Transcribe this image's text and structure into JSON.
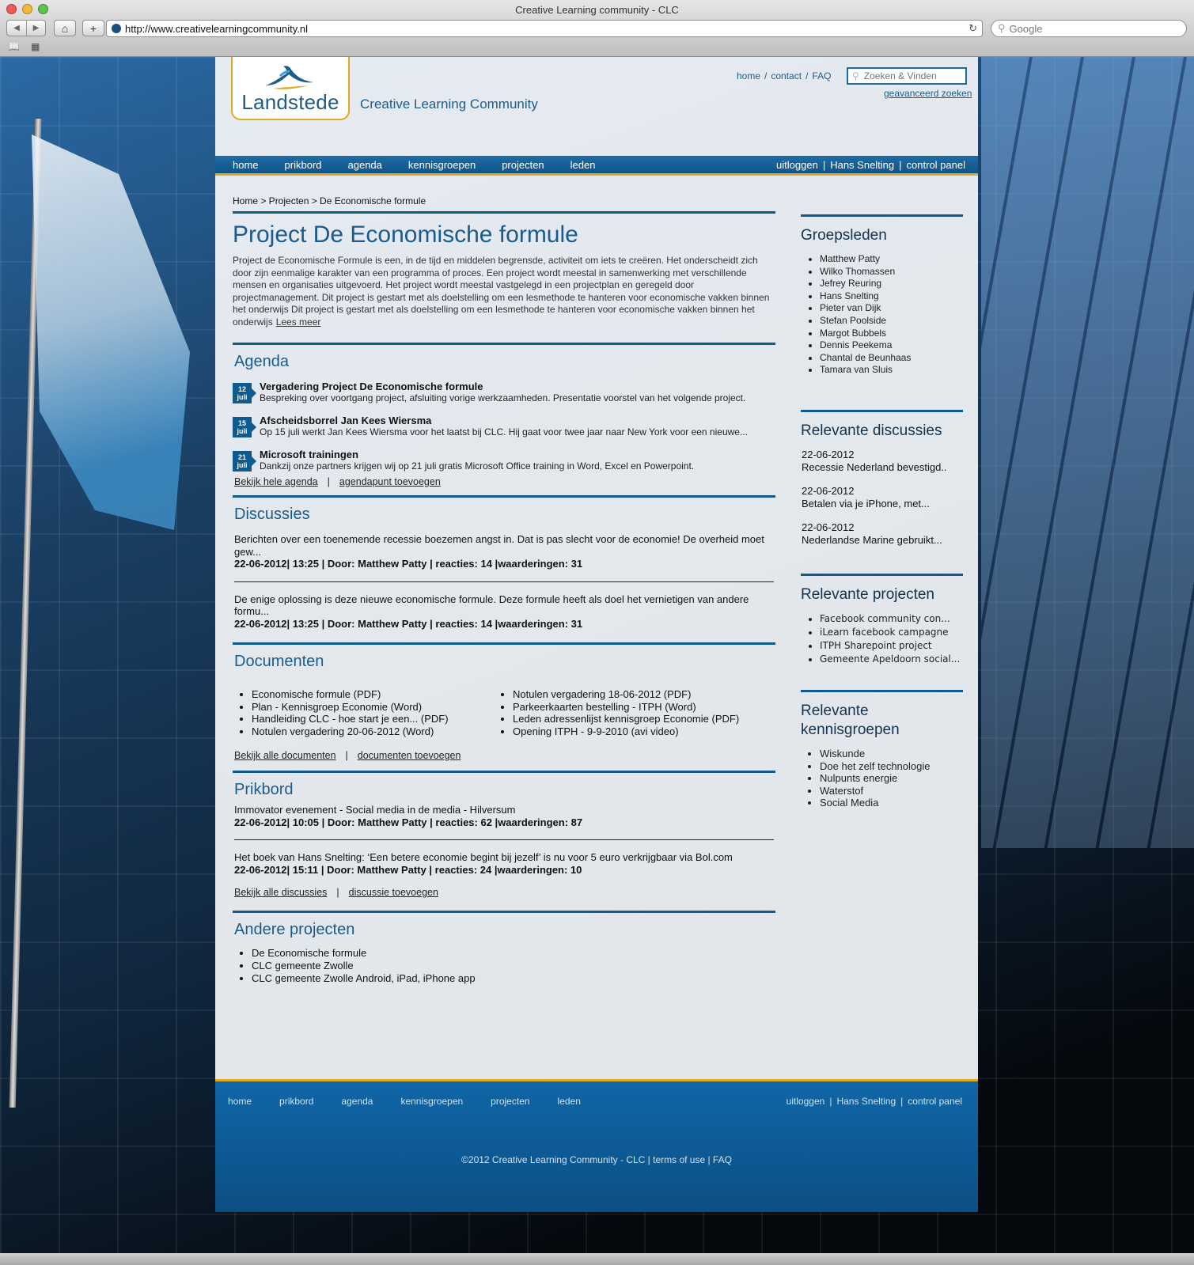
{
  "browser": {
    "window_title": "Creative Learning community - CLC",
    "url": "http://www.creativelearningcommunity.nl",
    "search_placeholder": "Google"
  },
  "site": {
    "logo_text": "Landstede",
    "tagline": "Creative Learning Community",
    "toplinks": [
      "home",
      "contact",
      "FAQ"
    ],
    "search_placeholder": "Zoeken & Vinden",
    "advanced_search": "geavanceerd zoeken"
  },
  "nav": {
    "items": [
      "home",
      "prikbord",
      "agenda",
      "kennisgroepen",
      "projecten",
      "leden"
    ],
    "right": [
      "uitloggen",
      "Hans Snelting",
      "control panel"
    ]
  },
  "main": {
    "breadcrumb": "Home > Projecten > De Economische formule",
    "title": "Project De Economische formule",
    "intro": "Project de Economische Formule is een, in de tijd en middelen begrensde, activiteit om iets te creëren. Het onderscheidt zich door zijn eenmalige karakter van een programma of proces. Een project wordt meestal in samenwerking met verschillende mensen en organisaties uitgevoerd. Het project wordt meestal vastgelegd in een projectplan en geregeld door projectmanagement. Dit project is gestart met als doelstelling om een lesmethode te hanteren voor economische vakken binnen het onderwijs  Dit project is gestart met als doelstelling om een lesmethode te hanteren voor economische vakken binnen het onderwijs",
    "read_more": "Lees meer",
    "agenda": {
      "heading": "Agenda",
      "items": [
        {
          "day": "12",
          "month": "juli",
          "title": "Vergadering Project De Economische formule",
          "desc": "Bespreking over voortgang project, afsluiting vorige werkzaamheden. Presentatie voorstel van het volgende project."
        },
        {
          "day": "15",
          "month": "juli",
          "title": "Afscheidsborrel Jan Kees Wiersma",
          "desc": "Op 15 juli werkt Jan Kees Wiersma voor het laatst bij CLC. Hij gaat voor twee jaar naar New York voor een nieuwe..."
        },
        {
          "day": "21",
          "month": "juli",
          "title": "Microsoft trainingen",
          "desc": "Dankzij onze partners krijgen wij op 21 juli gratis Microsoft Office training in Word, Excel en Powerpoint."
        }
      ],
      "link_all": "Bekijk hele agenda",
      "link_add": "agendapunt toevoegen"
    },
    "discussions": {
      "heading": "Discussies",
      "items": [
        {
          "text": "Berichten over een toenemende recessie boezemen angst in. Dat is pas slecht voor de economie! De overheid moet gew...",
          "meta": "22-06-2012| 13:25 | Door: Matthew Patty | reacties: 14 |waarderingen: 31"
        },
        {
          "text": "De enige oplossing is deze nieuwe economische formule. Deze formule heeft als doel het vernietigen van andere formu...",
          "meta": "22-06-2012| 13:25 | Door: Matthew Patty | reacties: 14 |waarderingen: 31"
        }
      ],
      "separator": "______________________________________________________________________________________"
    },
    "documents": {
      "heading": "Documenten",
      "col1": [
        "Economische formule (PDF)",
        "Plan - Kennisgroep Economie (Word)",
        "Handleiding CLC - hoe start je een... (PDF)",
        "Notulen vergadering 20-06-2012 (Word)"
      ],
      "col2": [
        "Notulen vergadering 18-06-2012 (PDF)",
        "Parkeerkaarten bestelling - ITPH (Word)",
        "Leden adressenlijst kennisgroep Economie (PDF)",
        "Opening ITPH - 9-9-2010 (avi video)"
      ],
      "link_all": "Bekijk alle documenten",
      "link_add": "documenten toevoegen"
    },
    "prikbord": {
      "heading": "Prikbord",
      "items": [
        {
          "text": "Immovator evenement - Social media in de media - Hilversum",
          "meta": "22-06-2012| 10:05 | Door: Matthew Patty | reacties: 62 |waarderingen: 87"
        },
        {
          "text": "Het boek van Hans Snelting: ‘Een betere economie begint bij jezelf’ is nu voor 5 euro verkrijgbaar via Bol.com",
          "meta": "22-06-2012| 15:11 | Door: Matthew Patty | reacties: 24 |waarderingen: 10"
        }
      ],
      "link_all": "Bekijk alle discussies",
      "link_add": "discussie toevoegen"
    },
    "other_projects": {
      "heading": "Andere projecten",
      "items": [
        "De Economische formule",
        "CLC gemeente Zwolle",
        "CLC gemeente Zwolle Android, iPad, iPhone app"
      ]
    }
  },
  "sidebar": {
    "members": {
      "heading": "Groepsleden",
      "items": [
        "Matthew Patty",
        "Wilko Thomassen",
        "Jefrey Reuring",
        "Hans Snelting",
        "Pieter van Dijk",
        "Stefan Poolside",
        "Margot Bubbels",
        "Dennis Peekema",
        "Chantal de Beunhaas",
        "Tamara van Sluis"
      ]
    },
    "discussions": {
      "heading": "Relevante discussies",
      "items": [
        {
          "date": "22-06-2012",
          "title": "Recessie Nederland bevestigd.."
        },
        {
          "date": "22-06-2012",
          "title": "Betalen via je iPhone, met..."
        },
        {
          "date": "22-06-2012",
          "title": "Nederlandse Marine gebruikt..."
        }
      ]
    },
    "projects": {
      "heading": "Relevante projecten",
      "items": [
        "Facebook community con...",
        "iLearn facebook campagne",
        "ITPH Sharepoint project",
        "Gemeente Apeldoorn social..."
      ]
    },
    "groups": {
      "heading": "Relevante kennisgroepen",
      "items": [
        "Wiskunde",
        "Doe het zelf technologie",
        "Nulpunts energie",
        "Waterstof",
        "Social Media"
      ]
    }
  },
  "footer": {
    "nav": [
      "home",
      "prikbord",
      "agenda",
      "kennisgroepen",
      "projecten",
      "leden"
    ],
    "right": [
      "uitloggen",
      "Hans Snelting",
      "control panel"
    ],
    "copyright": "©2012 Creative Learning Community - CLC  |  terms of use | FAQ"
  },
  "colors": {
    "brand_blue": "#0f5a8f",
    "accent_gold": "#e3a91f"
  }
}
